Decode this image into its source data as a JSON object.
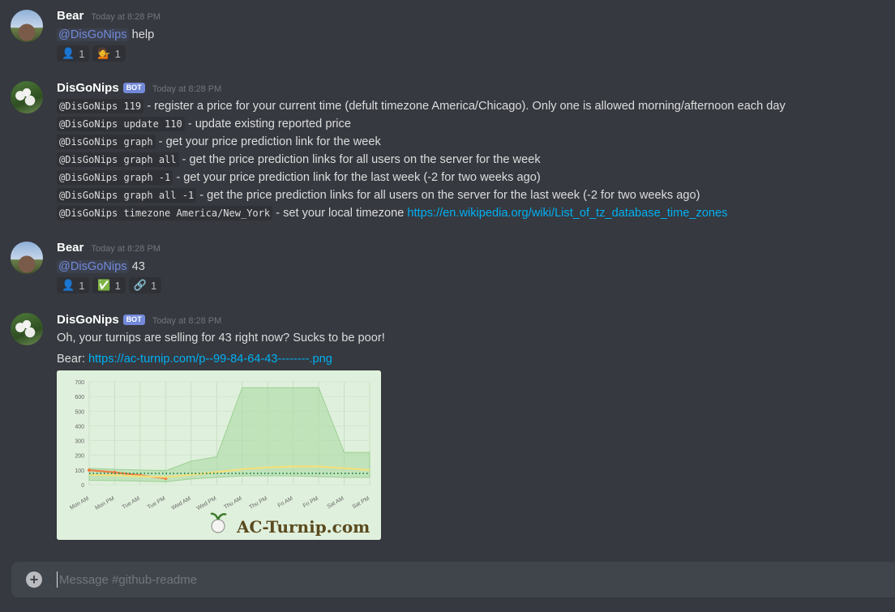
{
  "messages": [
    {
      "author": "Bear",
      "timestamp": "Today at 8:28 PM",
      "mention": "@DisGoNips",
      "text": " help",
      "reactions": [
        {
          "emoji": "👤",
          "count": "1"
        },
        {
          "emoji": "💁",
          "count": "1"
        }
      ]
    },
    {
      "author": "DisGoNips",
      "bot_tag": "BOT",
      "timestamp": "Today at 8:28 PM",
      "commands": [
        {
          "code": "@DisGoNips 119",
          "desc": " - register a price for your current time (defult timezone America/Chicago). Only one is allowed morning/afternoon each day"
        },
        {
          "code": "@DisGoNips update 110",
          "desc": " - update existing reported price"
        },
        {
          "code": "@DisGoNips graph",
          "desc": " - get your price prediction link for the week"
        },
        {
          "code": "@DisGoNips graph all",
          "desc": " - get the price prediction links for all users on the server for the week"
        },
        {
          "code": "@DisGoNips graph -1",
          "desc": " - get your price prediction link for the last week (-2 for two weeks ago)"
        },
        {
          "code": "@DisGoNips graph all -1",
          "desc": " - get the price prediction links for all users on the server for the last week (-2 for two weeks ago)"
        },
        {
          "code": "@DisGoNips timezone America/New_York",
          "desc": " - set your local timezone ",
          "link": "https://en.wikipedia.org/wiki/List_of_tz_database_time_zones"
        }
      ]
    },
    {
      "author": "Bear",
      "timestamp": "Today at 8:28 PM",
      "mention": "@DisGoNips",
      "text": " 43",
      "reactions": [
        {
          "emoji": "👤",
          "count": "1"
        },
        {
          "emoji": "✅",
          "count": "1"
        },
        {
          "emoji": "🔗",
          "count": "1"
        }
      ]
    },
    {
      "author": "DisGoNips",
      "bot_tag": "BOT",
      "timestamp": "Today at 8:28 PM",
      "text": "Oh, your turnips are selling for 43 right now? Sucks to be poor!",
      "link_prefix": "Bear: ",
      "link": "https://ac-turnip.com/p--99-84-64-43--------.png",
      "image_watermark": "AC-Turnip.com"
    }
  ],
  "composer": {
    "placeholder": "Message #github-readme"
  },
  "chart_data": {
    "type": "line",
    "categories": [
      "Mon AM",
      "Mon PM",
      "Tue AM",
      "Tue PM",
      "Wed AM",
      "Wed PM",
      "Thu AM",
      "Thu PM",
      "Fri AM",
      "Fri PM",
      "Sat AM",
      "Sat PM"
    ],
    "yticks": [
      "700",
      "600",
      "500",
      "400",
      "300",
      "200",
      "100",
      "0"
    ],
    "ylim": [
      0,
      700
    ],
    "series": [
      {
        "values": [
          99,
          84,
          64,
          43,
          null,
          null,
          null,
          null,
          null,
          null,
          null,
          null
        ],
        "color": "#f07b3f"
      },
      {
        "values": [
          68,
          64,
          58,
          52,
          68,
          86,
          105,
          118,
          124,
          124,
          112,
          100
        ],
        "color": "#f2e07a"
      },
      {
        "values": [
          77,
          77,
          77,
          77,
          77,
          77,
          77,
          77,
          77,
          77,
          77,
          77
        ],
        "color": "#2e8b57"
      },
      {
        "values": [
          110,
          105,
          100,
          95,
          160,
          190,
          660,
          660,
          660,
          660,
          220,
          220
        ],
        "color": "#a8d8a0"
      },
      {
        "values": [
          30,
          28,
          25,
          20,
          40,
          50,
          60,
          60,
          60,
          55,
          50,
          50
        ],
        "color": "#a8d8a0"
      }
    ]
  }
}
